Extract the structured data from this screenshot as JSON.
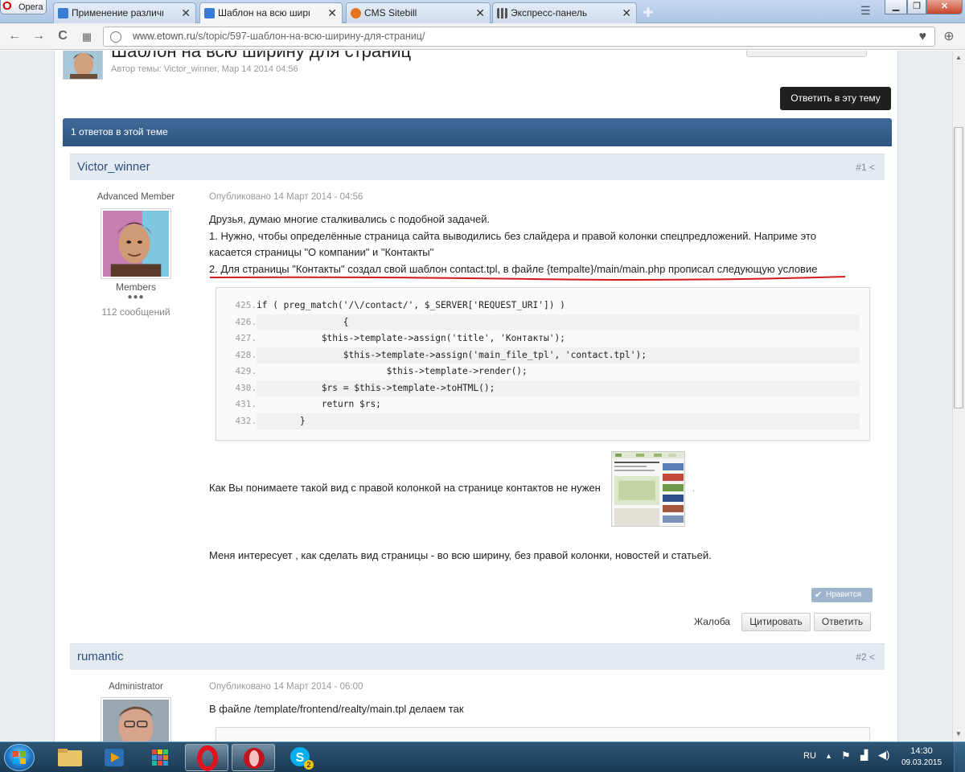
{
  "browser": {
    "menu_label": "Opera",
    "tabs": [
      {
        "title": "Применение различных",
        "icon_color": "#3a7bd5"
      },
      {
        "title": "Шаблон на всю ширину",
        "icon_color": "#3a7bd5"
      },
      {
        "title": "CMS Sitebill",
        "icon_color": "#e8741e"
      },
      {
        "title": "Экспресс-панель",
        "icon_color": "#555555"
      }
    ],
    "close_glyph": "✕",
    "url_host": "www.etown.ru",
    "url_path": "/s/topic/597-шаблон-на-всю-ширину-для-страниц/"
  },
  "topic": {
    "title": "Шаблон на всю ширину для страниц",
    "meta": "Автор темы: Victor_winner, Мар 14 2014 04:56",
    "reply_button": "Ответить в эту тему",
    "count_label": "1 ответов в этой теме"
  },
  "posts": [
    {
      "author": "Victor_winner",
      "number": "#1",
      "rank": "Advanced Member",
      "group": "Members",
      "pips": "●●●",
      "post_count": "112 сообщений",
      "posted": "Опубликовано 14 Март 2014 - 04:56",
      "lines": [
        "Друзья, думаю многие сталкивались с подобной задачей.",
        "1. Нужно, чтобы определённые страница сайта выводились без слайдера и правой колонки спецпредложений. Наприме это",
        "касается страницы \"О компании\" и \"Контакты\"",
        "2. Для страницы \"Контакты\" создал свой шаблон contact.tpl, в файле {tempalte}/main/main.php прописал следующую условие"
      ],
      "code": {
        "line_numbers": [
          "425.",
          "426.",
          "427.",
          "428.",
          "429.",
          "430.",
          "431.",
          "432."
        ],
        "lines": [
          "if ( preg_match('/\\/contact/', $_SERVER['REQUEST_URI']) )",
          "                {",
          "            $this->template->assign('title', 'Контакты');",
          "                $this->template->assign('main_file_tpl', 'contact.tpl');",
          "                        $this->template->render();",
          "            $rs = $this->template->toHTML();",
          "            return $rs;",
          "        }"
        ]
      },
      "image_caption": "Как Вы понимаете такой вид с правой колонкой на странице контактов не нужен",
      "image_trailer": ".",
      "closing": "Меня интересует , как сделать вид страницы - во всю ширину, без правой колонки, новостей и статьей.",
      "like_label": "Нравится",
      "report_label": "Жалоба",
      "quote_label": "Цитировать",
      "reply_label": "Ответить"
    },
    {
      "author": "rumantic",
      "number": "#2",
      "rank": "Administrator",
      "posted": "Опубликовано 14 Март 2014 - 06:00",
      "lines": [
        "В файле /template/frontend/realty/main.tpl делаем так"
      ]
    }
  ],
  "taskbar": {
    "lang": "RU",
    "time": "14:30",
    "date": "09.03.2015",
    "skype_badge": "2"
  },
  "colors": {
    "accent_blue": "#2c5480",
    "header_bg": "#e4eaf2",
    "underline_red": "#d21a1a"
  }
}
